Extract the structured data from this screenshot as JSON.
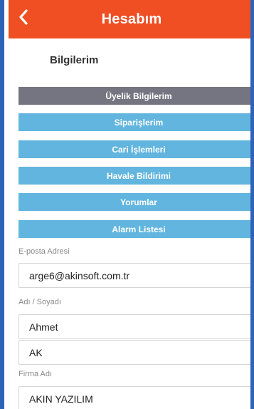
{
  "header": {
    "title": "Hesabım"
  },
  "section": {
    "title": "Bilgilerim"
  },
  "menu": [
    {
      "label": "Üyelik Bilgilerim"
    },
    {
      "label": "Siparişlerim"
    },
    {
      "label": "Cari İşlemleri"
    },
    {
      "label": "Havale Bildirimi"
    },
    {
      "label": "Yorumlar"
    },
    {
      "label": "Alarm Listesi"
    }
  ],
  "form": {
    "email_label": "E-posta Adresi",
    "email_value": "arge6@akinsoft.com.tr",
    "name_label": "Adı / Soyadı",
    "first_name_value": "Ahmet",
    "last_name_value": "AK",
    "company_label": "Firma Adı",
    "company_value": "AKIN YAZILIM"
  },
  "colors": {
    "topbar": "#f04e23",
    "menu_active": "#757581",
    "menu_default": "#62b5de",
    "frame": "#2f63b8"
  },
  "icons": {
    "back": "chevron-left-icon"
  }
}
